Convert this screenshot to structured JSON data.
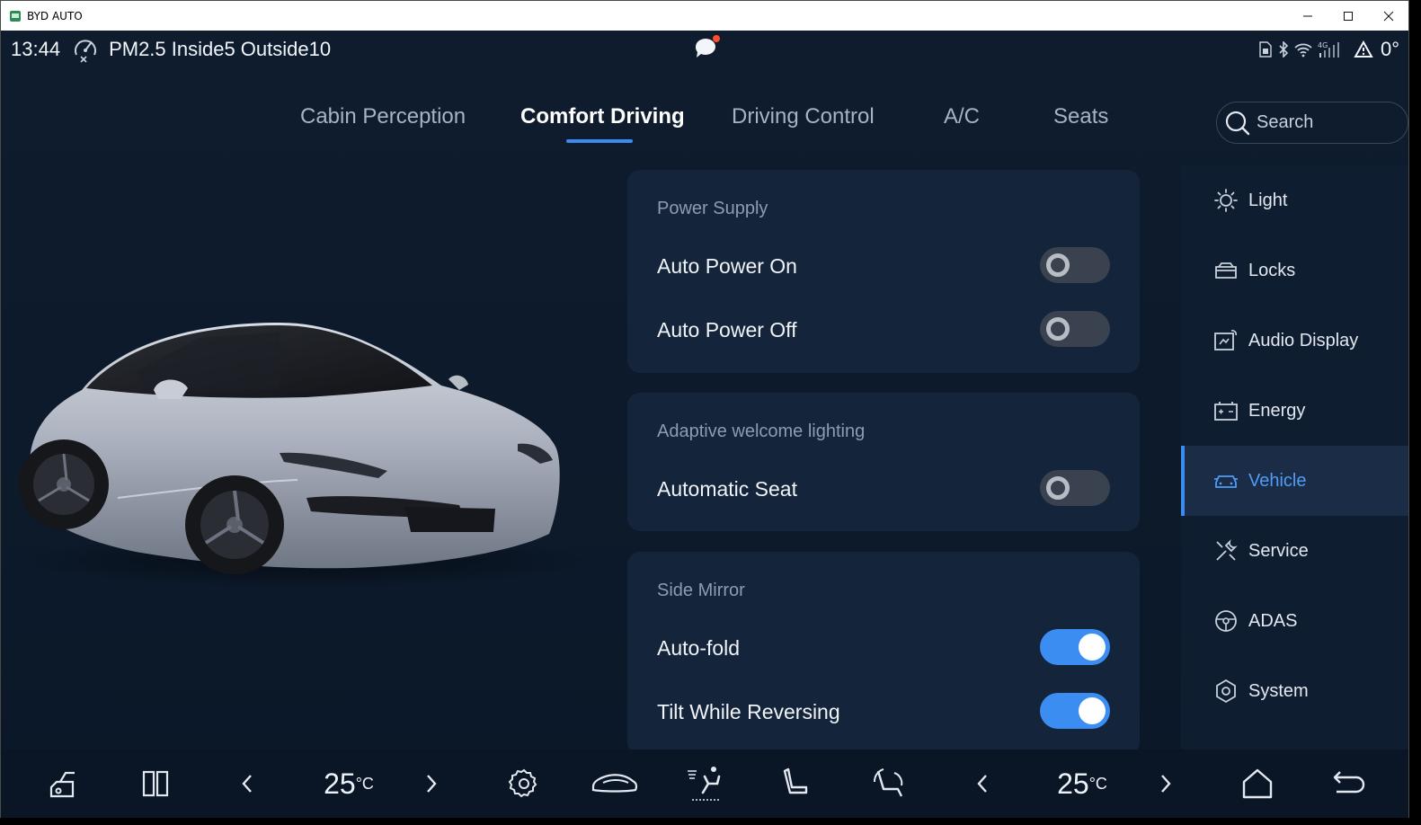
{
  "window": {
    "title": "BYD AUTO",
    "controls": {
      "minimize": "—",
      "maximize": "☐",
      "close": "✕"
    }
  },
  "status_bar": {
    "time": "13:44",
    "pm25_text": "PM2.5 Inside5 Outside10",
    "outside_temp": "0°",
    "icons": [
      "pm-sensor-icon",
      "chat-notification-icon",
      "sim-icon",
      "bluetooth-icon",
      "wifi-icon",
      "4g-signal-icon",
      "warning-triangle-icon"
    ]
  },
  "tabs": [
    {
      "label": "Cabin Perception",
      "active": false
    },
    {
      "label": "Comfort Driving",
      "active": true
    },
    {
      "label": "Driving Control",
      "active": false
    },
    {
      "label": "A/C",
      "active": false
    },
    {
      "label": "Seats",
      "active": false
    }
  ],
  "search": {
    "placeholder": "Search"
  },
  "panels": [
    {
      "header": "Power Supply",
      "rows": [
        {
          "label": "Auto Power On",
          "on": false
        },
        {
          "label": "Auto Power Off",
          "on": false
        }
      ]
    },
    {
      "header": "Adaptive welcome lighting",
      "rows": [
        {
          "label": "Automatic Seat",
          "on": false
        }
      ]
    },
    {
      "header": "Side Mirror",
      "rows": [
        {
          "label": "Auto-fold",
          "on": true
        },
        {
          "label": "Tilt While Reversing",
          "on": true
        }
      ]
    }
  ],
  "sidebar": {
    "items": [
      {
        "label": "Light",
        "icon": "light-icon",
        "active": false
      },
      {
        "label": "Locks",
        "icon": "lock-icon",
        "active": false
      },
      {
        "label": "Audio Display",
        "icon": "audio-display-icon",
        "active": false
      },
      {
        "label": "Energy",
        "icon": "energy-icon",
        "active": false
      },
      {
        "label": "Vehicle",
        "icon": "vehicle-icon",
        "active": true
      },
      {
        "label": "Service",
        "icon": "service-icon",
        "active": false
      },
      {
        "label": "ADAS",
        "icon": "adas-icon",
        "active": false
      },
      {
        "label": "System",
        "icon": "system-icon",
        "active": false
      }
    ]
  },
  "dock": {
    "left_temp": "25",
    "right_temp": "25",
    "temp_unit": "°C",
    "icons": [
      "car-park-icon",
      "split-view-icon",
      "chevron-left-icon",
      "chevron-right-icon",
      "settings-icon",
      "car-icon",
      "seat-ventilation-icon",
      "seat-heating-icon",
      "seat-recline-icon",
      "chevron-left-icon",
      "chevron-right-icon",
      "home-icon",
      "back-icon"
    ]
  },
  "colors": {
    "accent": "#3b8df2",
    "background": "#0d1a2b",
    "panel": "#14243a",
    "toggle_off": "#3a4250"
  }
}
